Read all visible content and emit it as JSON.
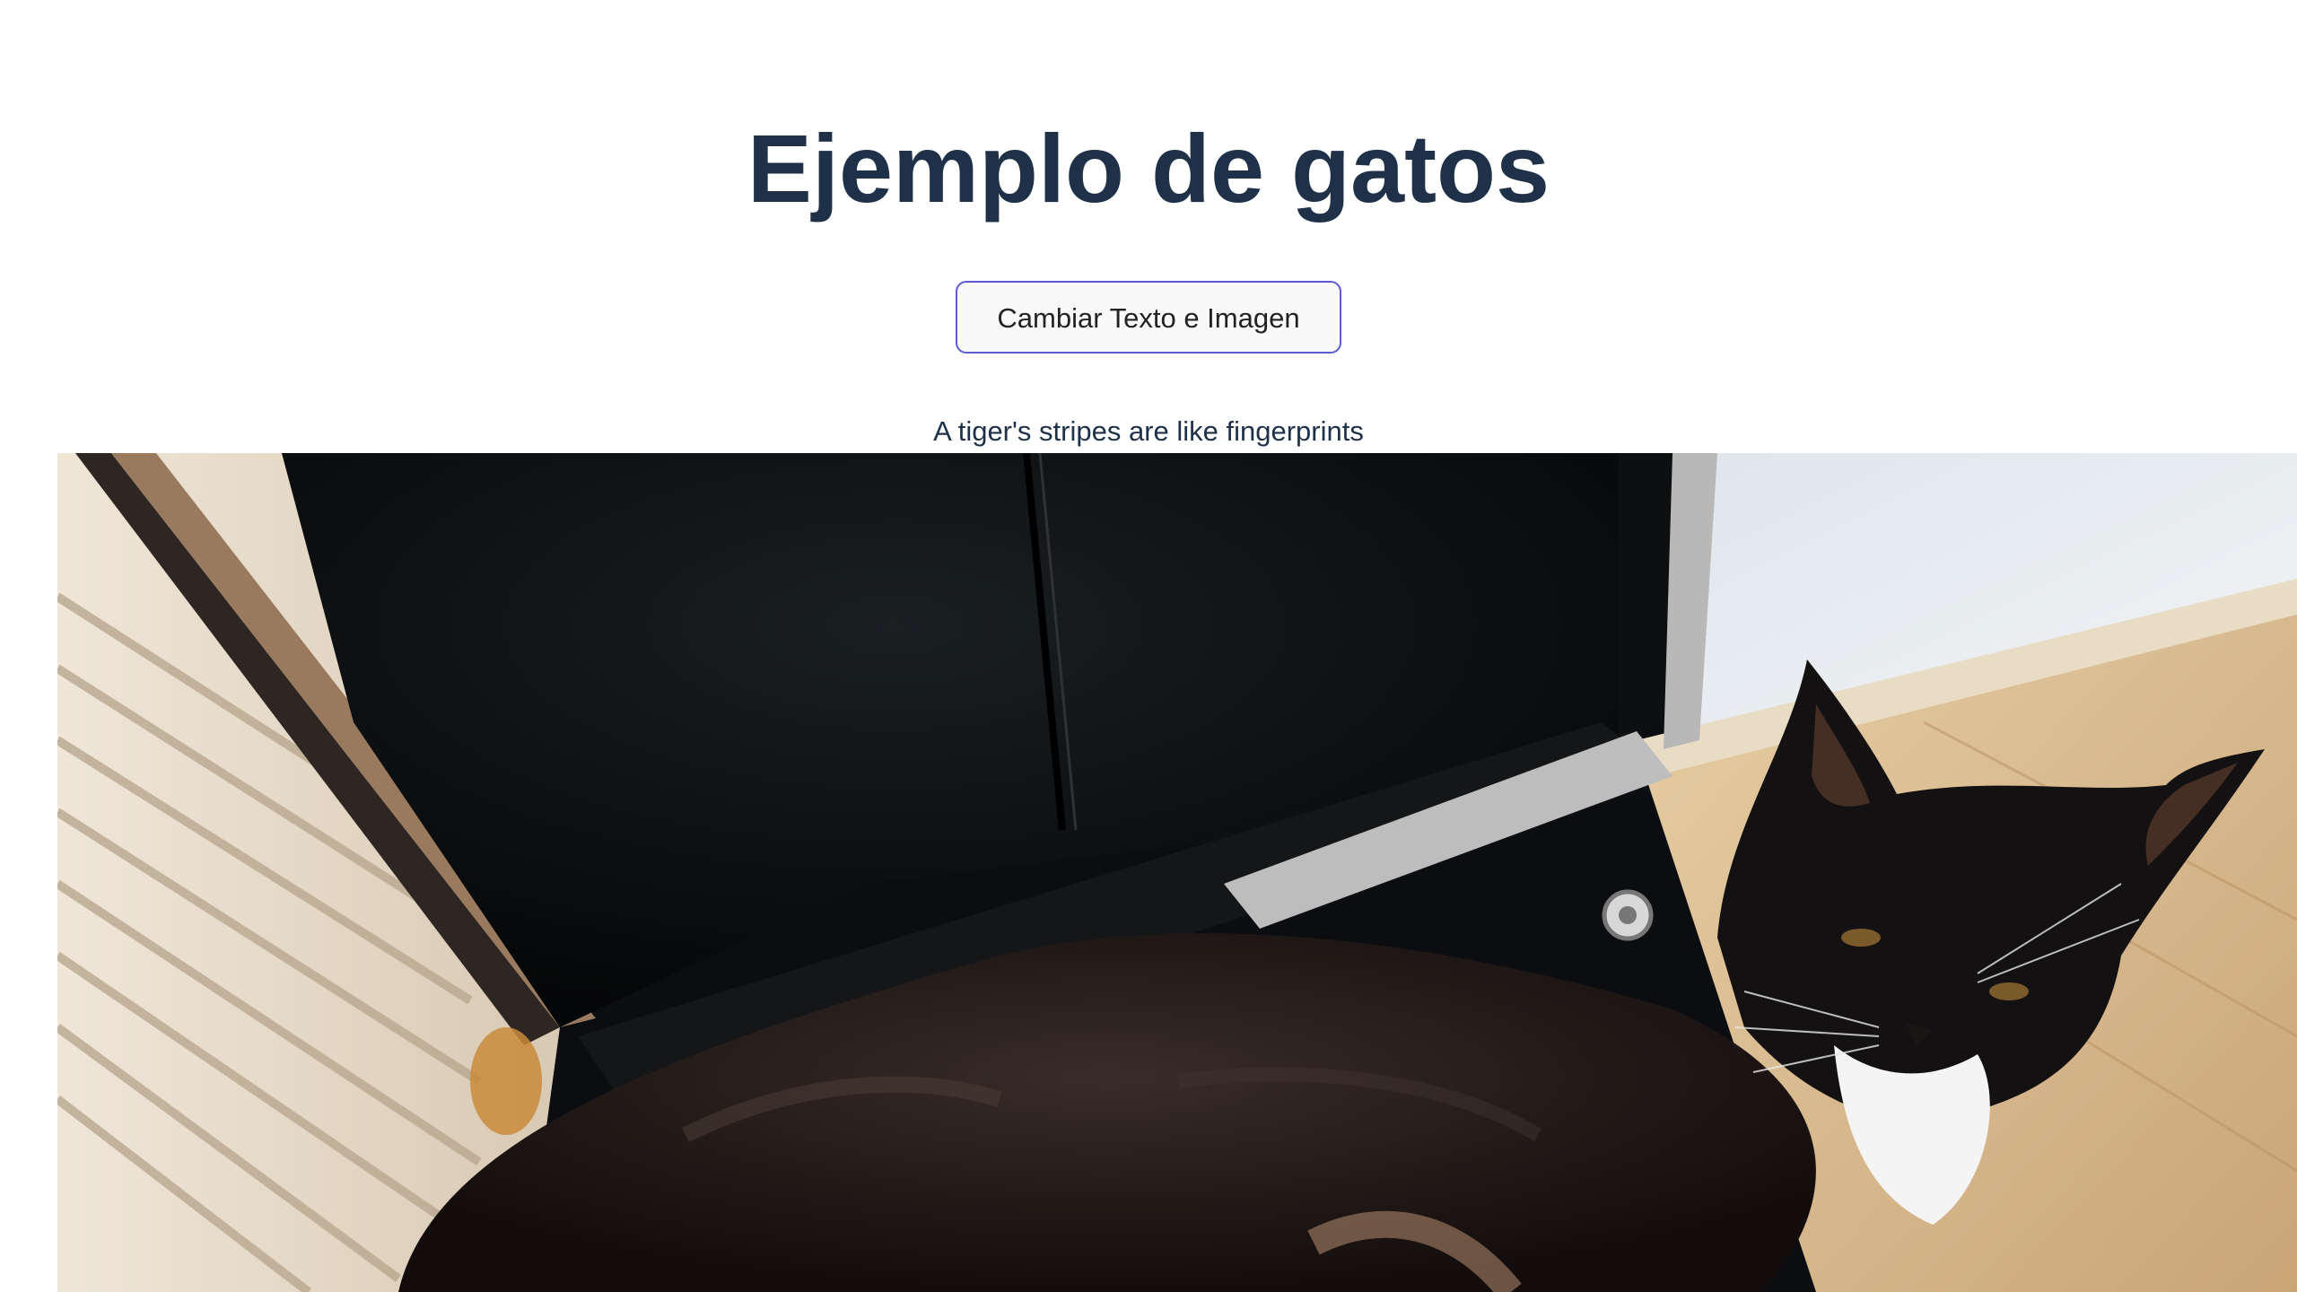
{
  "page": {
    "title": "Ejemplo de gatos",
    "button_label": "Cambiar Texto e Imagen",
    "fact_text": "A tiger's stripes are like fingerprints"
  },
  "colors": {
    "title": "#1e3148",
    "button_border": "#5b5bd6",
    "button_bg": "#f9f9f9"
  },
  "image": {
    "subject": "black-and-white tuxedo cat lying on a black leather chair"
  }
}
